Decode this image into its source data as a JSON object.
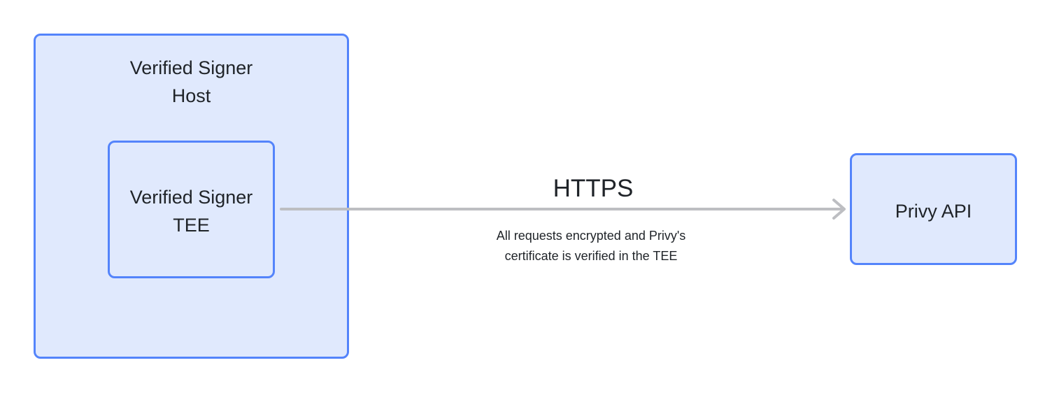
{
  "nodes": {
    "host": {
      "line1": "Verified Signer",
      "line2": "Host"
    },
    "tee": {
      "line1": "Verified Signer",
      "line2": "TEE"
    },
    "api": {
      "label": "Privy API"
    }
  },
  "edge": {
    "label": "HTTPS",
    "note_line1": "All requests encrypted and Privy's",
    "note_line2": "certificate is verified in the TEE"
  },
  "colors": {
    "fill": "#e0e9fd",
    "border": "#5484fb",
    "arrow": "#bdbec2"
  }
}
